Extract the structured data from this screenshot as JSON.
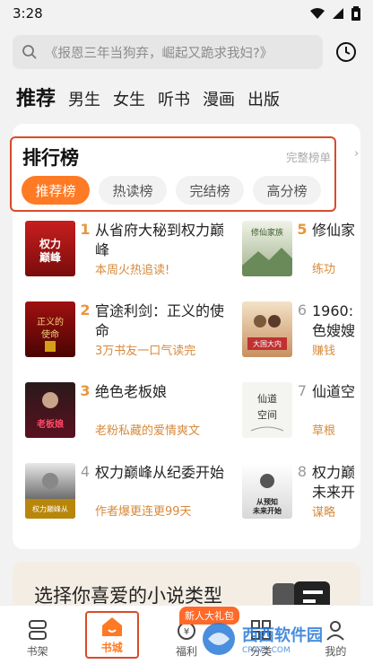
{
  "status": {
    "time": "3:28"
  },
  "search": {
    "placeholder": "《报恩三年当狗弃，崛起又跪求我妇?》"
  },
  "tabs": [
    {
      "label": "推荐",
      "active": true
    },
    {
      "label": "男生"
    },
    {
      "label": "女生"
    },
    {
      "label": "听书"
    },
    {
      "label": "漫画"
    },
    {
      "label": "出版"
    }
  ],
  "ranking": {
    "title": "排行榜",
    "more": "完整榜单",
    "chips": [
      "推荐榜",
      "热读榜",
      "完结榜",
      "高分榜"
    ],
    "active_chip": "推荐榜",
    "books": [
      {
        "rank": "1",
        "title": "从省府大秘到权力巅峰",
        "tag": "本周火热追读!",
        "cover_text": "权力巅峰"
      },
      {
        "rank": "2",
        "title": "官途利剑：正义的使命",
        "tag": "3万书友一口气读完",
        "cover_text": "正义的使命"
      },
      {
        "rank": "3",
        "title": "绝色老板娘",
        "tag": "老粉私藏的爱情爽文",
        "cover_text": "绝色老板娘"
      },
      {
        "rank": "4",
        "title": "权力巅峰从纪委开始",
        "tag": "作者爆更连更99天",
        "cover_text": "权力巅峰从纪委开始"
      },
      {
        "rank": "5",
        "title": "修仙家",
        "tag": "练功",
        "cover_text": "修仙家族"
      },
      {
        "rank": "6",
        "title": "1960:色嫂嫂",
        "tag": "赚钱",
        "cover_text": "大国大内"
      },
      {
        "rank": "7",
        "title": "仙道空",
        "tag": "草根",
        "cover_text": "仙道空间"
      },
      {
        "rank": "8",
        "title": "权力巅未来开",
        "tag": "谋略",
        "cover_text": "从预知未来开始"
      }
    ]
  },
  "choose": {
    "text": "选择你喜爱的小说类型"
  },
  "nav": {
    "items": [
      {
        "label": "书架",
        "icon": "bookshelf-icon"
      },
      {
        "label": "书城",
        "icon": "home-icon",
        "active": true
      },
      {
        "label": "福利",
        "icon": "gift-icon"
      },
      {
        "label": "分类",
        "icon": "category-icon"
      },
      {
        "label": "我的",
        "icon": "user-icon"
      }
    ],
    "badge": "新人大礼包"
  },
  "watermark": {
    "text": "西西软件园",
    "sub": "CR173.COM"
  },
  "colors": {
    "accent": "#ff7a24",
    "rank_top": "#e8963d",
    "tag": "#d88a3a",
    "highlight": "#d94b2b"
  }
}
